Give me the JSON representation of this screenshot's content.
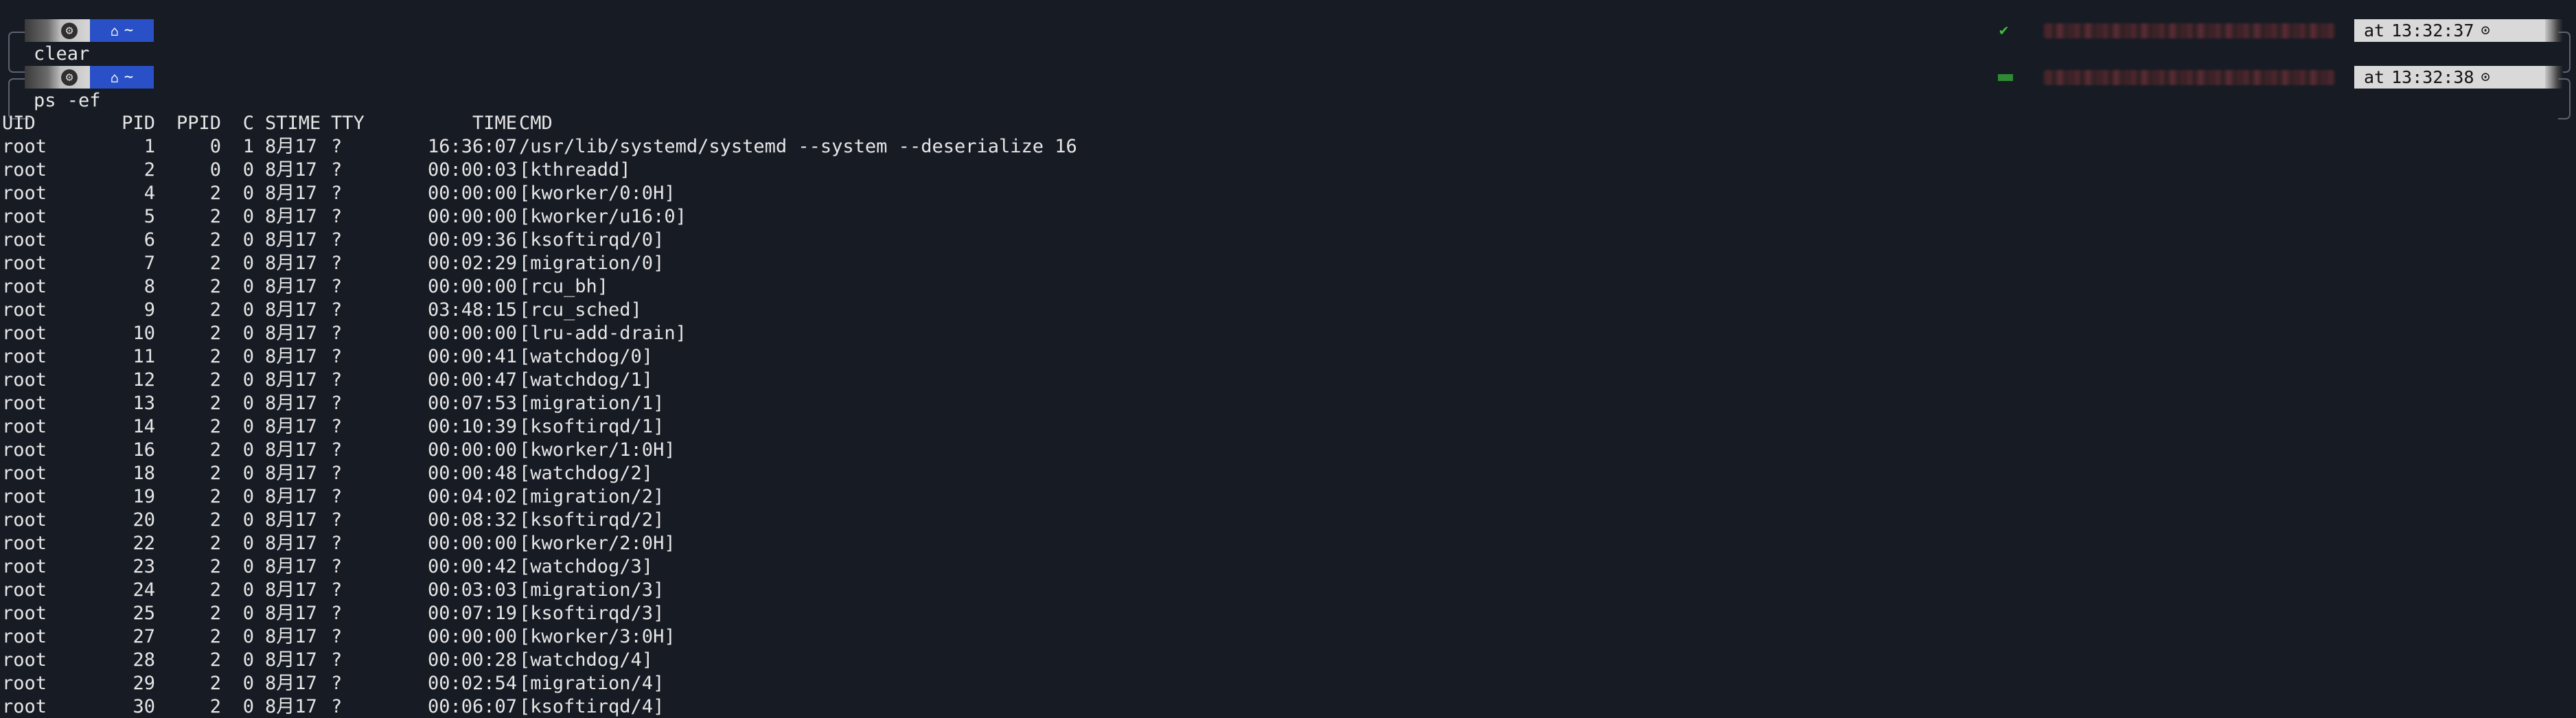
{
  "prompts": [
    {
      "os_icon": "gear-icon",
      "dir_icon": "home-icon",
      "dir": "~",
      "command": "clear",
      "status_icon": "check-icon",
      "status": "✔",
      "time_prefix": "at",
      "time": "13:32:37",
      "clock_icon": "clock-icon",
      "clock": "⊙"
    },
    {
      "os_icon": "gear-icon",
      "dir_icon": "home-icon",
      "dir": "~",
      "command": "ps -ef",
      "status_icon": "running-bar-icon",
      "time_prefix": "at",
      "time": "13:32:38",
      "clock_icon": "clock-icon",
      "clock": "⊙"
    }
  ],
  "ps": {
    "headers": {
      "uid": "UID",
      "pid": "PID",
      "ppid": "PPID",
      "c": "C",
      "stime": "STIME",
      "tty": "TTY",
      "time": "TIME",
      "cmd": "CMD"
    },
    "rows": [
      {
        "uid": "root",
        "pid": "1",
        "ppid": "0",
        "c": "1",
        "stime": "8月17",
        "tty": "?",
        "time": "16:36:07",
        "cmd": "/usr/lib/systemd/systemd --system --deserialize 16"
      },
      {
        "uid": "root",
        "pid": "2",
        "ppid": "0",
        "c": "0",
        "stime": "8月17",
        "tty": "?",
        "time": "00:00:03",
        "cmd": "[kthreadd]"
      },
      {
        "uid": "root",
        "pid": "4",
        "ppid": "2",
        "c": "0",
        "stime": "8月17",
        "tty": "?",
        "time": "00:00:00",
        "cmd": "[kworker/0:0H]"
      },
      {
        "uid": "root",
        "pid": "5",
        "ppid": "2",
        "c": "0",
        "stime": "8月17",
        "tty": "?",
        "time": "00:00:00",
        "cmd": "[kworker/u16:0]"
      },
      {
        "uid": "root",
        "pid": "6",
        "ppid": "2",
        "c": "0",
        "stime": "8月17",
        "tty": "?",
        "time": "00:09:36",
        "cmd": "[ksoftirqd/0]"
      },
      {
        "uid": "root",
        "pid": "7",
        "ppid": "2",
        "c": "0",
        "stime": "8月17",
        "tty": "?",
        "time": "00:02:29",
        "cmd": "[migration/0]"
      },
      {
        "uid": "root",
        "pid": "8",
        "ppid": "2",
        "c": "0",
        "stime": "8月17",
        "tty": "?",
        "time": "00:00:00",
        "cmd": "[rcu_bh]"
      },
      {
        "uid": "root",
        "pid": "9",
        "ppid": "2",
        "c": "0",
        "stime": "8月17",
        "tty": "?",
        "time": "03:48:15",
        "cmd": "[rcu_sched]"
      },
      {
        "uid": "root",
        "pid": "10",
        "ppid": "2",
        "c": "0",
        "stime": "8月17",
        "tty": "?",
        "time": "00:00:00",
        "cmd": "[lru-add-drain]"
      },
      {
        "uid": "root",
        "pid": "11",
        "ppid": "2",
        "c": "0",
        "stime": "8月17",
        "tty": "?",
        "time": "00:00:41",
        "cmd": "[watchdog/0]"
      },
      {
        "uid": "root",
        "pid": "12",
        "ppid": "2",
        "c": "0",
        "stime": "8月17",
        "tty": "?",
        "time": "00:00:47",
        "cmd": "[watchdog/1]"
      },
      {
        "uid": "root",
        "pid": "13",
        "ppid": "2",
        "c": "0",
        "stime": "8月17",
        "tty": "?",
        "time": "00:07:53",
        "cmd": "[migration/1]"
      },
      {
        "uid": "root",
        "pid": "14",
        "ppid": "2",
        "c": "0",
        "stime": "8月17",
        "tty": "?",
        "time": "00:10:39",
        "cmd": "[ksoftirqd/1]"
      },
      {
        "uid": "root",
        "pid": "16",
        "ppid": "2",
        "c": "0",
        "stime": "8月17",
        "tty": "?",
        "time": "00:00:00",
        "cmd": "[kworker/1:0H]"
      },
      {
        "uid": "root",
        "pid": "18",
        "ppid": "2",
        "c": "0",
        "stime": "8月17",
        "tty": "?",
        "time": "00:00:48",
        "cmd": "[watchdog/2]"
      },
      {
        "uid": "root",
        "pid": "19",
        "ppid": "2",
        "c": "0",
        "stime": "8月17",
        "tty": "?",
        "time": "00:04:02",
        "cmd": "[migration/2]"
      },
      {
        "uid": "root",
        "pid": "20",
        "ppid": "2",
        "c": "0",
        "stime": "8月17",
        "tty": "?",
        "time": "00:08:32",
        "cmd": "[ksoftirqd/2]"
      },
      {
        "uid": "root",
        "pid": "22",
        "ppid": "2",
        "c": "0",
        "stime": "8月17",
        "tty": "?",
        "time": "00:00:00",
        "cmd": "[kworker/2:0H]"
      },
      {
        "uid": "root",
        "pid": "23",
        "ppid": "2",
        "c": "0",
        "stime": "8月17",
        "tty": "?",
        "time": "00:00:42",
        "cmd": "[watchdog/3]"
      },
      {
        "uid": "root",
        "pid": "24",
        "ppid": "2",
        "c": "0",
        "stime": "8月17",
        "tty": "?",
        "time": "00:03:03",
        "cmd": "[migration/3]"
      },
      {
        "uid": "root",
        "pid": "25",
        "ppid": "2",
        "c": "0",
        "stime": "8月17",
        "tty": "?",
        "time": "00:07:19",
        "cmd": "[ksoftirqd/3]"
      },
      {
        "uid": "root",
        "pid": "27",
        "ppid": "2",
        "c": "0",
        "stime": "8月17",
        "tty": "?",
        "time": "00:00:00",
        "cmd": "[kworker/3:0H]"
      },
      {
        "uid": "root",
        "pid": "28",
        "ppid": "2",
        "c": "0",
        "stime": "8月17",
        "tty": "?",
        "time": "00:00:28",
        "cmd": "[watchdog/4]"
      },
      {
        "uid": "root",
        "pid": "29",
        "ppid": "2",
        "c": "0",
        "stime": "8月17",
        "tty": "?",
        "time": "00:02:54",
        "cmd": "[migration/4]"
      },
      {
        "uid": "root",
        "pid": "30",
        "ppid": "2",
        "c": "0",
        "stime": "8月17",
        "tty": "?",
        "time": "00:06:07",
        "cmd": "[ksoftirqd/4]"
      }
    ]
  },
  "colors": {
    "background": "#171b24",
    "text": "#e6e6e6",
    "dir_segment": "#2a50c8",
    "time_segment": "#d9d9d9",
    "status_ok": "#3fbf3f",
    "status_running": "#2e8a35"
  }
}
